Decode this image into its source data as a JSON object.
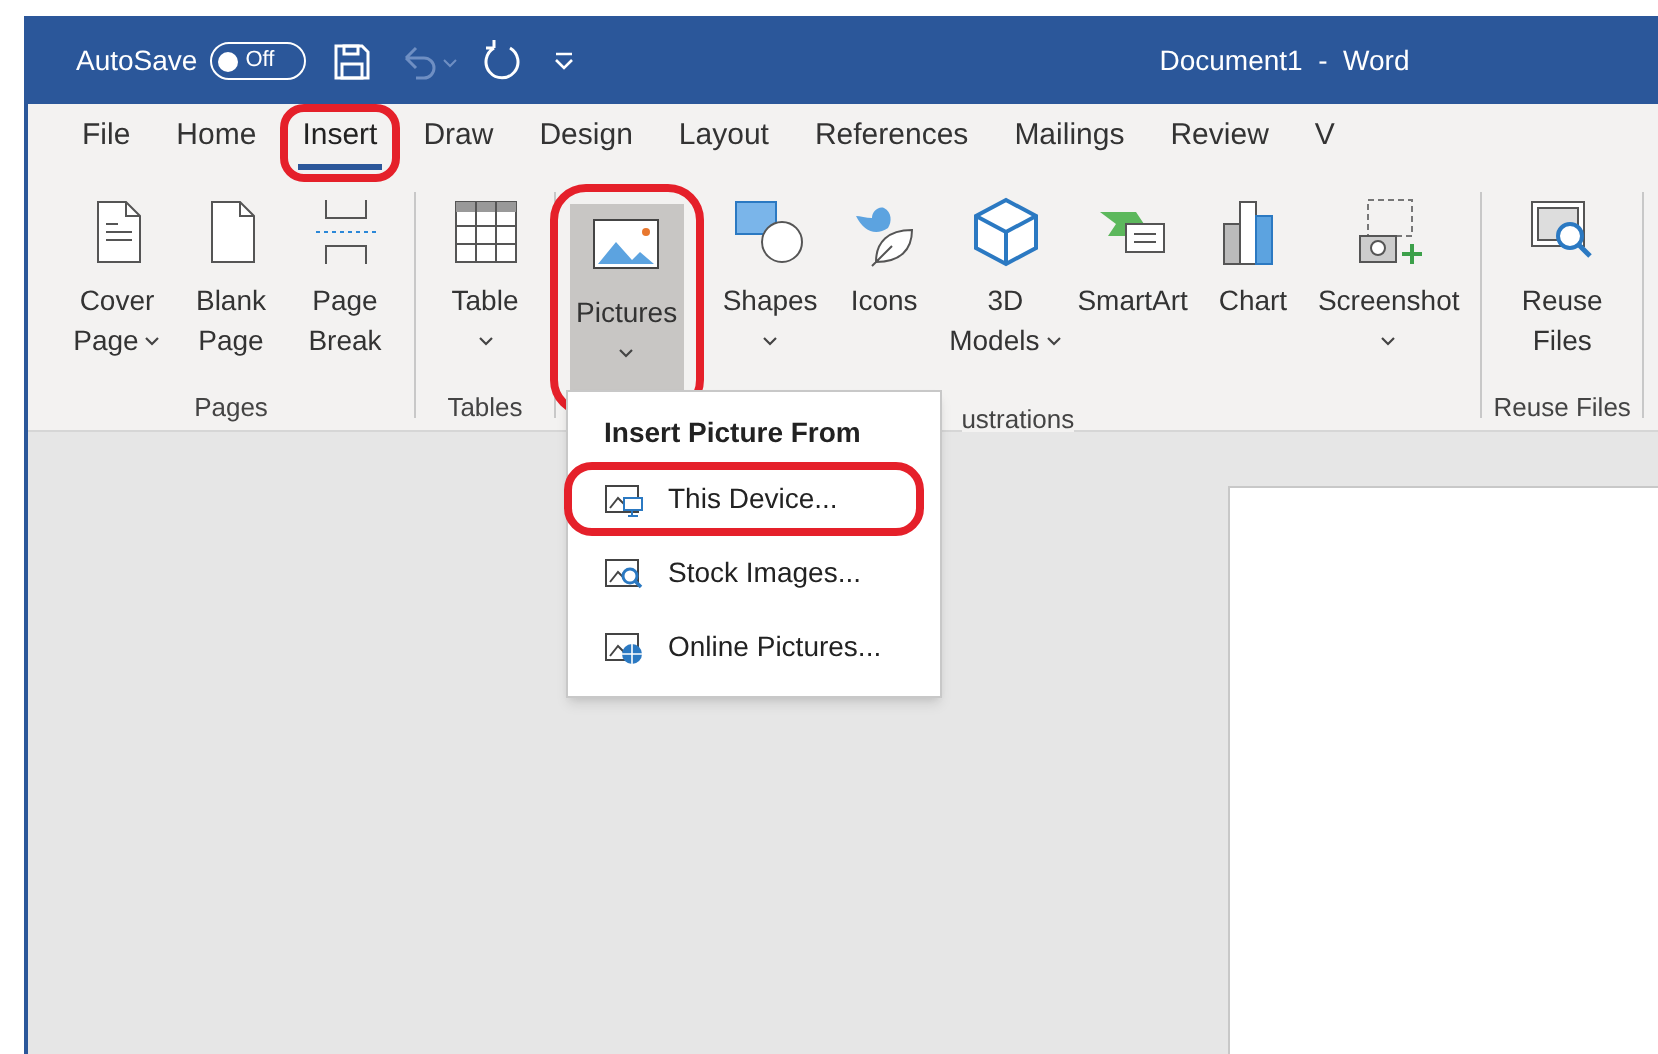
{
  "title_bar": {
    "autosave_label": "AutoSave",
    "autosave_toggle": {
      "label": "Off",
      "on": false
    },
    "title": "Document1  -  Word"
  },
  "tabs": [
    {
      "label": "File",
      "selected": false,
      "highlighted": false
    },
    {
      "label": "Home",
      "selected": false,
      "highlighted": false
    },
    {
      "label": "Insert",
      "selected": true,
      "highlighted": true
    },
    {
      "label": "Draw",
      "selected": false,
      "highlighted": false
    },
    {
      "label": "Design",
      "selected": false,
      "highlighted": false
    },
    {
      "label": "Layout",
      "selected": false,
      "highlighted": false
    },
    {
      "label": "References",
      "selected": false,
      "highlighted": false
    },
    {
      "label": "Mailings",
      "selected": false,
      "highlighted": false
    },
    {
      "label": "Review",
      "selected": false,
      "highlighted": false
    },
    {
      "label": "V",
      "selected": false,
      "highlighted": false
    }
  ],
  "ribbon_groups": [
    {
      "label": "Pages",
      "buttons": [
        {
          "kind": "cover",
          "lines": [
            "Cover",
            "Page"
          ],
          "dropdown": true,
          "pressed": false,
          "highlighted": false
        },
        {
          "kind": "blank",
          "lines": [
            "Blank",
            "Page"
          ],
          "dropdown": false,
          "pressed": false,
          "highlighted": false
        },
        {
          "kind": "break",
          "lines": [
            "Page",
            "Break"
          ],
          "dropdown": false,
          "pressed": false,
          "highlighted": false
        }
      ]
    },
    {
      "label": "Tables",
      "buttons": [
        {
          "kind": "table",
          "lines": [
            "Table"
          ],
          "dropdown": true,
          "pressed": false,
          "highlighted": false
        }
      ]
    },
    {
      "label": "ustrations",
      "buttons": [
        {
          "kind": "pictures",
          "lines": [
            "Pictures"
          ],
          "dropdown": true,
          "pressed": true,
          "highlighted": true
        },
        {
          "kind": "shapes",
          "lines": [
            "Shapes"
          ],
          "dropdown": true,
          "pressed": false,
          "highlighted": false
        },
        {
          "kind": "icons",
          "lines": [
            "Icons"
          ],
          "dropdown": false,
          "pressed": false,
          "highlighted": false
        },
        {
          "kind": "models",
          "lines": [
            "3D",
            "Models"
          ],
          "dropdown": true,
          "pressed": false,
          "highlighted": false
        },
        {
          "kind": "smartart",
          "lines": [
            "SmartArt"
          ],
          "dropdown": false,
          "pressed": false,
          "highlighted": false
        },
        {
          "kind": "chart",
          "lines": [
            "Chart"
          ],
          "dropdown": false,
          "pressed": false,
          "highlighted": false
        },
        {
          "kind": "screenshot",
          "lines": [
            "Screenshot"
          ],
          "dropdown": true,
          "pressed": false,
          "highlighted": false
        }
      ]
    },
    {
      "label": "Reuse Files",
      "buttons": [
        {
          "kind": "reuse",
          "lines": [
            "Reuse",
            "Files"
          ],
          "dropdown": false,
          "pressed": false,
          "highlighted": false
        }
      ]
    }
  ],
  "menu": {
    "title": "Insert Picture From",
    "items": [
      {
        "kind": "device",
        "label": "This Device...",
        "highlighted": true
      },
      {
        "kind": "stock",
        "label": "Stock Images...",
        "highlighted": false
      },
      {
        "kind": "online",
        "label": "Online Pictures...",
        "highlighted": false
      }
    ]
  }
}
